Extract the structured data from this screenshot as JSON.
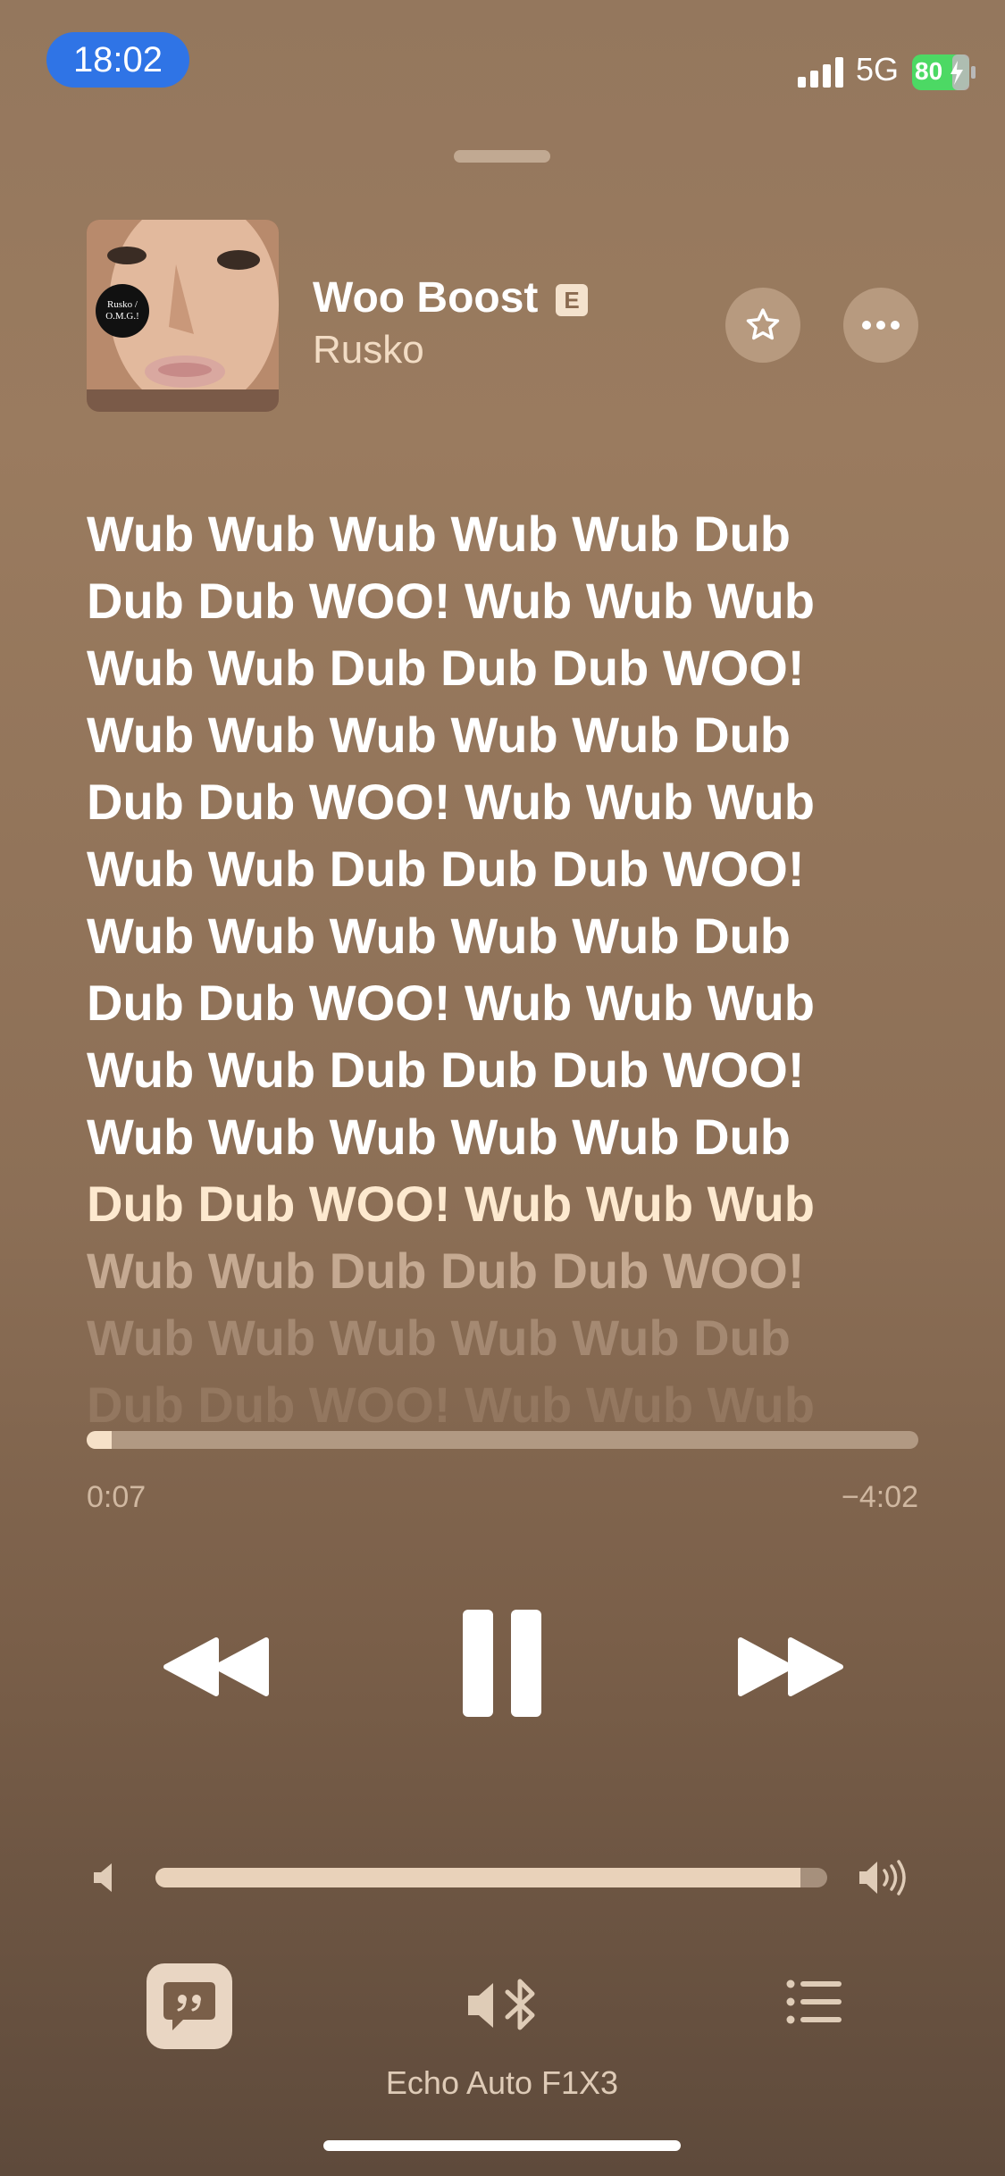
{
  "status_bar": {
    "time": "18:02",
    "network": "5G",
    "battery": "80"
  },
  "now_playing": {
    "title": "Woo Boost",
    "explicit_badge": "E",
    "artist": "Rusko",
    "album_art_text": "Rusko / O.M.G.!",
    "favorite_icon": "star-icon",
    "more_icon": "ellipsis-icon"
  },
  "lyrics": {
    "lines": [
      {
        "text": "Wub Wub Wub Wub Wub Dub",
        "state": "past"
      },
      {
        "text": "Dub Dub WOO! Wub Wub Wub",
        "state": "past"
      },
      {
        "text": "Wub Wub Dub Dub Dub WOO!",
        "state": "past"
      },
      {
        "text": "Wub Wub Wub Wub Wub Dub",
        "state": "past"
      },
      {
        "text": "Dub Dub WOO! Wub Wub Wub",
        "state": "past"
      },
      {
        "text": "Wub Wub Dub Dub Dub WOO!",
        "state": "past"
      },
      {
        "text": "Wub Wub Wub Wub Wub Dub",
        "state": "past"
      },
      {
        "text": "Dub Dub WOO! Wub Wub Wub",
        "state": "past"
      },
      {
        "text": "Wub Wub Dub Dub Dub WOO!",
        "state": "past"
      },
      {
        "text": "Wub Wub Wub Wub Wub Dub",
        "state": "past"
      },
      {
        "text": "Dub Dub WOO! Wub Wub Wub",
        "state": "current"
      },
      {
        "text": "Wub Wub Dub Dub Dub WOO!",
        "state": "upcoming"
      },
      {
        "text": "Wub Wub Wub Wub Wub Dub",
        "state": "upcoming"
      },
      {
        "text": "Dub Dub WOO! Wub Wub Wub",
        "state": "upcoming"
      }
    ]
  },
  "playback": {
    "elapsed": "0:07",
    "remaining": "−4:02",
    "progress": 0.03
  },
  "controls": {
    "rewind_icon": "rewind-icon",
    "pause_icon": "pause-icon",
    "forward_icon": "fast-forward-icon"
  },
  "volume": {
    "level": 0.96,
    "low_icon": "volume-low-icon",
    "high_icon": "volume-high-icon"
  },
  "bottom_bar": {
    "lyrics_icon": "quote-bubble-icon",
    "output_icon": "bluetooth-speaker-icon",
    "queue_icon": "list-icon",
    "output_device": "Echo Auto F1X3"
  },
  "colors": {
    "accent_time_pill": "#2f74e6",
    "battery": "#4cd964",
    "lyric_past": "#ffffff",
    "lyric_current": "#fde9cf"
  }
}
